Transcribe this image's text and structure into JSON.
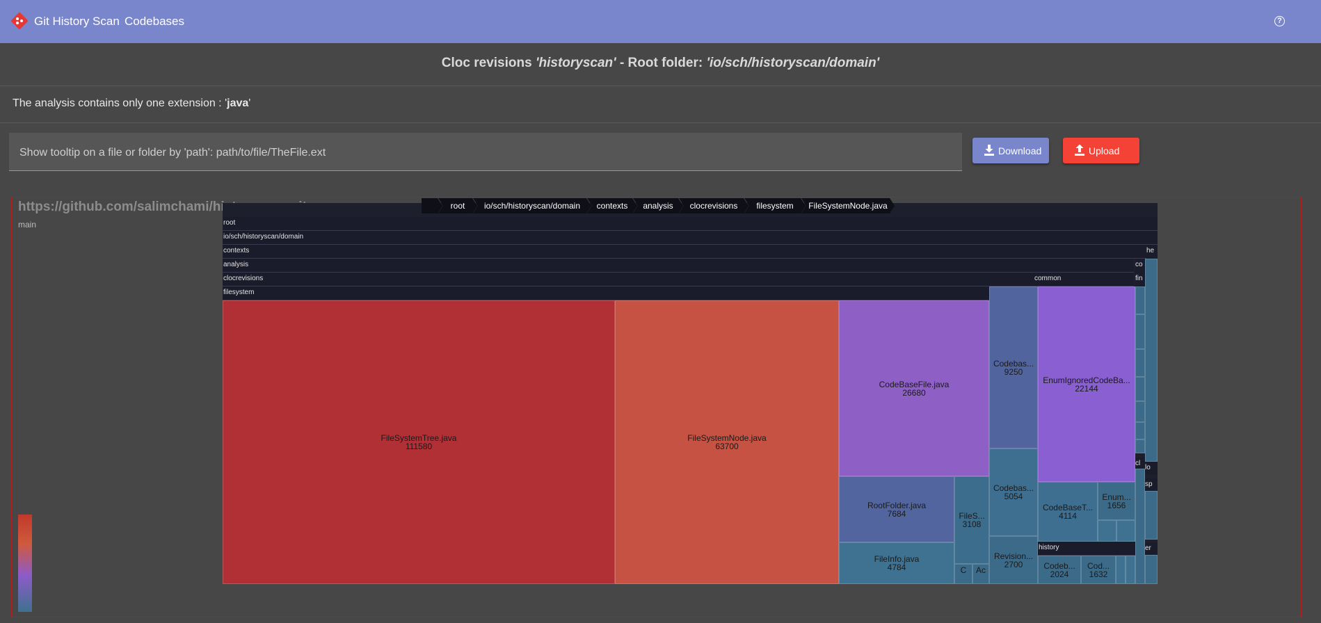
{
  "appbar": {
    "title": "Git History Scan",
    "nav": "Codebases",
    "help_icon": "?"
  },
  "heading": {
    "prefix": "Cloc revisions ",
    "project": "'historyscan'",
    "middle": " - Root folder: ",
    "folder": "'io/sch/historyscan/domain'"
  },
  "extension_line": {
    "text": "The analysis contains only one extension : '",
    "ext": "java",
    "suffix": "'"
  },
  "search": {
    "placeholder": "Show tooltip on a file or folder by 'path': path/to/file/TheFile.ext"
  },
  "buttons": {
    "download": "Download",
    "upload": "Upload"
  },
  "repo": {
    "url": "https://github.com/salimchami/historyscan.git",
    "branch": "main"
  },
  "breadcrumb": [
    "root",
    "io/sch/historyscan/domain",
    "contexts",
    "analysis",
    "clocrevisions",
    "filesystem",
    "FileSystemNode.java"
  ],
  "treemap": {
    "folders": {
      "root": "root",
      "domain": "io/sch/historyscan/domain",
      "contexts": "contexts",
      "analysis": "analysis",
      "clocrevisions": "clocrevisions",
      "filesystem": "filesystem",
      "common": "common",
      "history": "history"
    },
    "side_labels": {
      "he": "he",
      "co": "co",
      "fin": "fin",
      "cl": "cl",
      "lo": "lo",
      "sp": "sp",
      "er": "er"
    },
    "cells": [
      {
        "name": "FileSystemTree.java",
        "value": "111580",
        "color": "#b03035"
      },
      {
        "name": "FileSystemNode.java",
        "value": "63700",
        "color": "#c55242"
      },
      {
        "name": "CodeBaseFile.java",
        "value": "26680",
        "color": "#8e5fc5"
      },
      {
        "name": "RootFolder.java",
        "value": "7684",
        "color": "#52659e"
      },
      {
        "name": "FileInfo.java",
        "value": "4784",
        "color": "#3f7190"
      },
      {
        "name": "FileS...",
        "value": "3108",
        "color": "#3d6d8c"
      },
      {
        "name": "C",
        "value": "",
        "color": "#3c6b89"
      },
      {
        "name": "Ac",
        "value": "",
        "color": "#3c6b89"
      },
      {
        "name": "Codebas...",
        "value": "9250",
        "color": "#51649e"
      },
      {
        "name": "Codebas...",
        "value": "5054",
        "color": "#3f6f90"
      },
      {
        "name": "Revision...",
        "value": "2700",
        "color": "#3c6b89"
      },
      {
        "name": "EnumIgnoredCodeBa...",
        "value": "22144",
        "color": "#895fd2"
      },
      {
        "name": "CodeBaseT...",
        "value": "4114",
        "color": "#3f6f90"
      },
      {
        "name": "Enum...",
        "value": "1656",
        "color": "#3c6b89"
      },
      {
        "name": "Codeb...",
        "value": "2024",
        "color": "#3c6b89"
      },
      {
        "name": "Cod...",
        "value": "1632",
        "color": "#3c6b89"
      }
    ]
  }
}
